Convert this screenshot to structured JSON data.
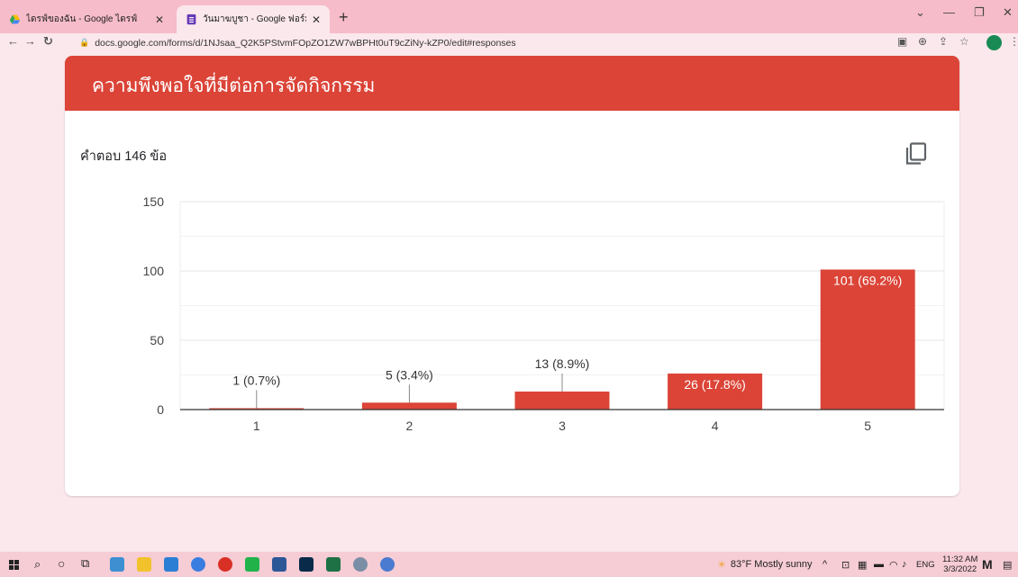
{
  "browser": {
    "tabs": [
      {
        "title": "ไดรฟ์ของฉัน - Google ไดรฟ์",
        "icon": "google-drive-icon",
        "active": false
      },
      {
        "title": "วันมาฆบูชา - Google ฟอร์ม",
        "icon": "google-forms-icon",
        "active": true
      }
    ],
    "new_tab": "+",
    "url": "docs.google.com/forms/d/1NJsaa_Q2K5PStvmFOpZO1ZW7wBPHt0uT9cZiNy-kZP0/edit#responses"
  },
  "card": {
    "title": "ความพึงพอใจที่มีต่อการจัดกิจกรรม",
    "responses_label": "คำตอบ 146 ข้อ",
    "accent_color": "#db4437"
  },
  "chart_data": {
    "type": "bar",
    "categories": [
      "1",
      "2",
      "3",
      "4",
      "5"
    ],
    "values": [
      1,
      5,
      13,
      26,
      101
    ],
    "labels": [
      "1 (0.7%)",
      "5 (3.4%)",
      "13 (8.9%)",
      "26 (17.8%)",
      "101 (69.2%)"
    ],
    "yticks": [
      "0",
      "50",
      "100",
      "150"
    ],
    "ylim": [
      0,
      150
    ],
    "bar_color": "#db4437",
    "grid": true
  },
  "taskbar": {
    "weather": "83°F  Mostly sunny",
    "language": "ENG",
    "time": "11:32 AM",
    "date": "3/3/2022"
  }
}
